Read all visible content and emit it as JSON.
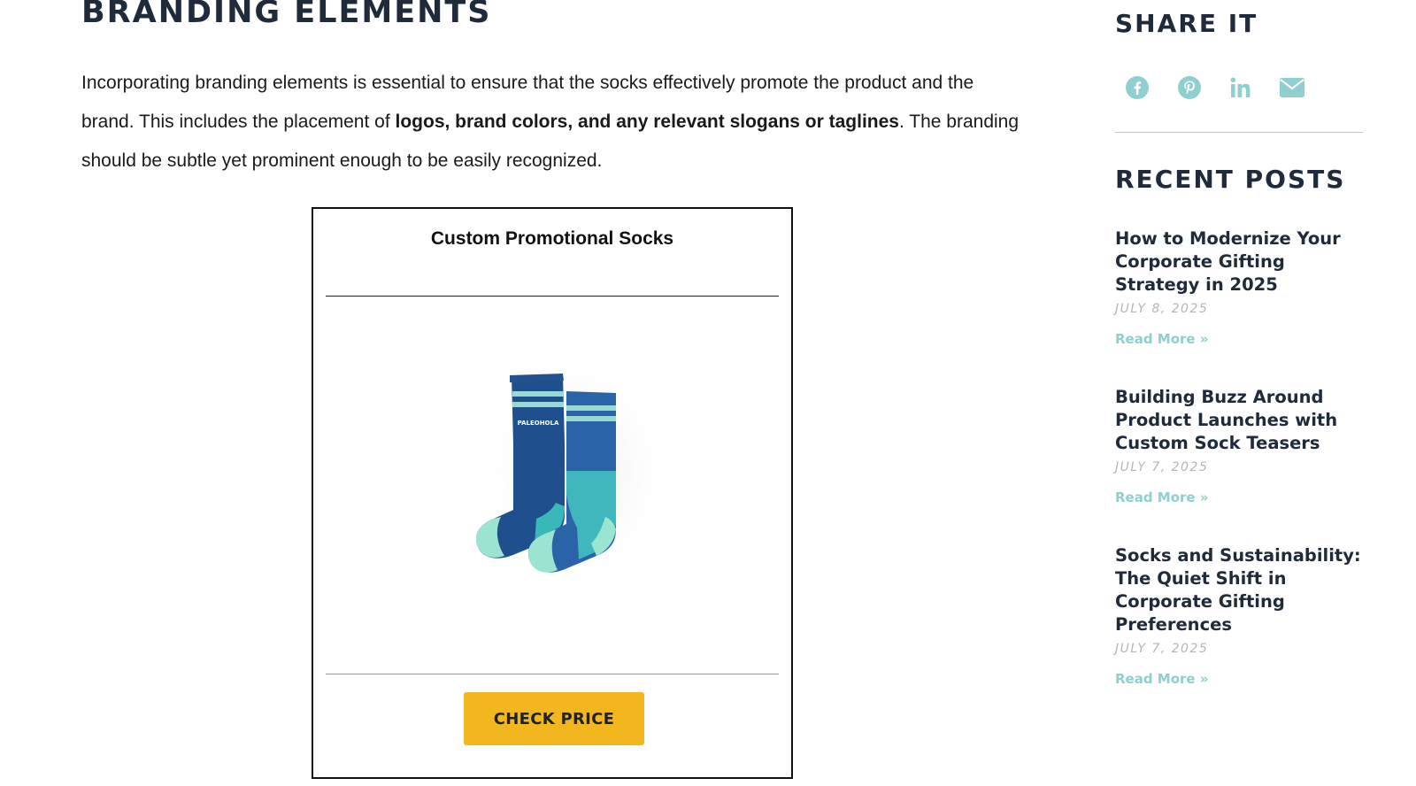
{
  "section": {
    "title": "BRANDING ELEMENTS",
    "paragraph": {
      "part1": "Incorporating branding elements is essential to ensure that the socks effectively promote the product and the brand. This includes the placement of ",
      "bold1": "logos, brand colors, and any relevant slogans or taglines",
      "part2": ". The branding should be subtle yet prominent enough to be easily recognized."
    }
  },
  "product_card": {
    "title": "Custom Promotional Socks",
    "button_label": "CHECK PRICE",
    "sock_brand_text": "PALEOHOLA"
  },
  "sidebar": {
    "share_heading": "SHARE IT",
    "social_icons": [
      "facebook-icon",
      "pinterest-icon",
      "linkedin-icon",
      "email-icon"
    ],
    "recent_heading": "RECENT POSTS",
    "posts": [
      {
        "title": "How to Modernize Your Corporate Gifting Strategy in 2025",
        "date": "JULY 8, 2025",
        "read_more": "Read More »"
      },
      {
        "title": "Building Buzz Around Product Launches with Custom Sock Teasers",
        "date": "JULY 7, 2025",
        "read_more": "Read More »"
      },
      {
        "title": "Socks and Sustainability: The Quiet Shift in Corporate Gifting Preferences",
        "date": "JULY 7, 2025",
        "read_more": "Read More »"
      }
    ]
  },
  "colors": {
    "heading": "#1f2a3a",
    "accent_teal": "#8fcfcf",
    "button_yellow": "#f2b71f",
    "divider_gold": "#e8c66a"
  }
}
